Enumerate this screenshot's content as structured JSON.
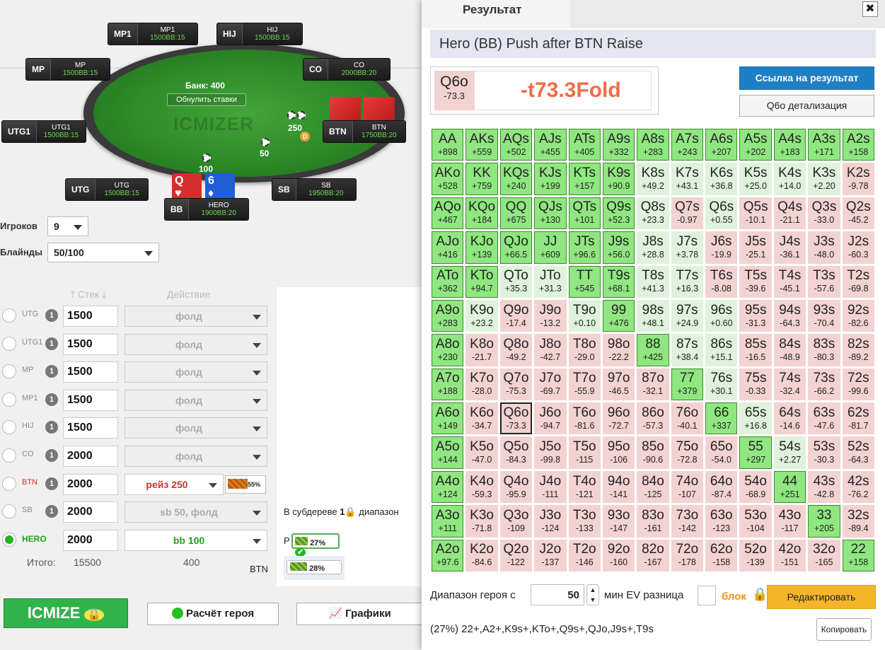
{
  "table": {
    "bank": "Банк: 400",
    "reset": "Обнулить ставки",
    "watermark": "ICMIZER",
    "pot_btn": "250",
    "pot_sb": "50",
    "pot_bb": "100",
    "dealer": "D",
    "seats": [
      {
        "pos": "MP1",
        "name": "MP1",
        "stack": "1500",
        "bb": "BB:15"
      },
      {
        "pos": "HIJ",
        "name": "HIJ",
        "stack": "1500",
        "bb": "BB:15"
      },
      {
        "pos": "MP",
        "name": "MP",
        "stack": "1500",
        "bb": "BB:15"
      },
      {
        "pos": "CO",
        "name": "CO",
        "stack": "2000",
        "bb": "BB:20"
      },
      {
        "pos": "UTG1",
        "name": "UTG1",
        "stack": "1500",
        "bb": "BB:15"
      },
      {
        "pos": "BTN",
        "name": "BTN",
        "stack": "1750",
        "bb": "BB:20"
      },
      {
        "pos": "UTG",
        "name": "UTG",
        "stack": "1500",
        "bb": "BB:15"
      },
      {
        "pos": "SB",
        "name": "SB",
        "stack": "1950",
        "bb": "BB:20"
      },
      {
        "pos": "BB",
        "name": "HERO",
        "stack": "1900",
        "bb": "BB:20"
      }
    ],
    "hero_cards": [
      {
        "rank": "Q",
        "suit": "♥",
        "color": "#d32f2f"
      },
      {
        "rank": "6",
        "suit": "♦",
        "color": "#1e5fd6"
      }
    ]
  },
  "setup": {
    "players_label": "Игроков",
    "players_value": "9",
    "blinds_label": "Блайнды",
    "blinds_value": "50/100",
    "stack_hdr": "Стек",
    "action_hdr": "Действие",
    "rows": [
      {
        "pos": "UTG",
        "stack": "1500",
        "action": "фолд"
      },
      {
        "pos": "UTG1",
        "stack": "1500",
        "action": "фолд"
      },
      {
        "pos": "MP",
        "stack": "1500",
        "action": "фолд"
      },
      {
        "pos": "MP1",
        "stack": "1500",
        "action": "фолд"
      },
      {
        "pos": "HIJ",
        "stack": "1500",
        "action": "фолд"
      },
      {
        "pos": "CO",
        "stack": "2000",
        "action": "фолд"
      },
      {
        "pos": "BTN",
        "stack": "2000",
        "action": "рейз 250"
      },
      {
        "pos": "SB",
        "stack": "2000",
        "action": "sb 50, фолд"
      },
      {
        "pos": "HERO",
        "stack": "2000",
        "action": "bb 100"
      }
    ],
    "row_num": "1",
    "btn_pct": "55%",
    "total_label": "Итого:",
    "total_stack": "15500",
    "total_action": "400"
  },
  "subtree": {
    "text_a": "В субдереве",
    "text_b": "1",
    "text_c": "диапазон",
    "r_label": "P",
    "r_pct": "27%",
    "btn_label": "BTN",
    "btn_pct": "28%"
  },
  "buttons": {
    "icmize": "ICMIZE",
    "hero_calc": "Расчёт героя",
    "charts": "Графики"
  },
  "result": {
    "tab": "Результат",
    "close": "✖",
    "title": "Hero (BB) Push after BTN Raise",
    "hand": "Q6o",
    "hand_ev": "-73.3",
    "verdict": "-t73.3Fold",
    "link_btn": "Ссылка на результат",
    "detail_btn": "Q6o детализация",
    "range_label": "Диапазон героя с",
    "range_value": "50",
    "ev_label": "мин EV разница",
    "block_label": "блок",
    "edit_btn": "Редактировать",
    "summary": "(27%) 22+,A2+,K9s+,KTo+,Q9s+,QJo,J9s+,T9s",
    "copy_btn": "Копировать",
    "colors": {
      "push": "#90e680",
      "pos_fold": "#dff2dc",
      "neg": "#f3d2d2",
      "accent": "#1f7fc4",
      "edit": "#f5b52a",
      "verdict": "#f26b4a"
    },
    "grid": [
      [
        [
          "AA",
          "+898"
        ],
        [
          "AKs",
          "+559"
        ],
        [
          "AQs",
          "+502"
        ],
        [
          "AJs",
          "+455"
        ],
        [
          "ATs",
          "+405"
        ],
        [
          "A9s",
          "+332"
        ],
        [
          "A8s",
          "+283"
        ],
        [
          "A7s",
          "+243"
        ],
        [
          "A6s",
          "+207"
        ],
        [
          "A5s",
          "+202"
        ],
        [
          "A4s",
          "+183"
        ],
        [
          "A3s",
          "+171"
        ],
        [
          "A2s",
          "+158"
        ]
      ],
      [
        [
          "AKo",
          "+528"
        ],
        [
          "KK",
          "+759"
        ],
        [
          "KQs",
          "+240"
        ],
        [
          "KJs",
          "+199"
        ],
        [
          "KTs",
          "+157"
        ],
        [
          "K9s",
          "+90.9"
        ],
        [
          "K8s",
          "+49.2"
        ],
        [
          "K7s",
          "+43.1"
        ],
        [
          "K6s",
          "+36.8"
        ],
        [
          "K5s",
          "+25.0"
        ],
        [
          "K4s",
          "+14.0"
        ],
        [
          "K3s",
          "+2.20"
        ],
        [
          "K2s",
          "-9.78"
        ]
      ],
      [
        [
          "AQo",
          "+467"
        ],
        [
          "KQo",
          "+184"
        ],
        [
          "QQ",
          "+675"
        ],
        [
          "QJs",
          "+130"
        ],
        [
          "QTs",
          "+101"
        ],
        [
          "Q9s",
          "+52.3"
        ],
        [
          "Q8s",
          "+23.3"
        ],
        [
          "Q7s",
          "-0.97"
        ],
        [
          "Q6s",
          "+0.55"
        ],
        [
          "Q5s",
          "-10.1"
        ],
        [
          "Q4s",
          "-21.1"
        ],
        [
          "Q3s",
          "-33.0"
        ],
        [
          "Q2s",
          "-45.2"
        ]
      ],
      [
        [
          "AJo",
          "+416"
        ],
        [
          "KJo",
          "+139"
        ],
        [
          "QJo",
          "+66.5"
        ],
        [
          "JJ",
          "+609"
        ],
        [
          "JTs",
          "+96.6"
        ],
        [
          "J9s",
          "+56.0"
        ],
        [
          "J8s",
          "+28.8"
        ],
        [
          "J7s",
          "+3.78"
        ],
        [
          "J6s",
          "-19.9"
        ],
        [
          "J5s",
          "-25.1"
        ],
        [
          "J4s",
          "-36.1"
        ],
        [
          "J3s",
          "-48.0"
        ],
        [
          "J2s",
          "-60.3"
        ]
      ],
      [
        [
          "ATo",
          "+362"
        ],
        [
          "KTo",
          "+94.7"
        ],
        [
          "QTo",
          "+35.3"
        ],
        [
          "JTo",
          "+31.3"
        ],
        [
          "TT",
          "+545"
        ],
        [
          "T9s",
          "+68.1"
        ],
        [
          "T8s",
          "+41.3"
        ],
        [
          "T7s",
          "+16.3"
        ],
        [
          "T6s",
          "-8.08"
        ],
        [
          "T5s",
          "-39.6"
        ],
        [
          "T4s",
          "-45.1"
        ],
        [
          "T3s",
          "-57.6"
        ],
        [
          "T2s",
          "-69.8"
        ]
      ],
      [
        [
          "A9o",
          "+283"
        ],
        [
          "K9o",
          "+23.2"
        ],
        [
          "Q9o",
          "-17.4"
        ],
        [
          "J9o",
          "-13.2"
        ],
        [
          "T9o",
          "+0.10"
        ],
        [
          "99",
          "+476"
        ],
        [
          "98s",
          "+48.1"
        ],
        [
          "97s",
          "+24.9"
        ],
        [
          "96s",
          "+0.60"
        ],
        [
          "95s",
          "-31.3"
        ],
        [
          "94s",
          "-64.3"
        ],
        [
          "93s",
          "-70.4"
        ],
        [
          "92s",
          "-82.6"
        ]
      ],
      [
        [
          "A8o",
          "+230"
        ],
        [
          "K8o",
          "-21.7"
        ],
        [
          "Q8o",
          "-49.2"
        ],
        [
          "J8o",
          "-42.7"
        ],
        [
          "T8o",
          "-29.0"
        ],
        [
          "98o",
          "-22.2"
        ],
        [
          "88",
          "+425"
        ],
        [
          "87s",
          "+38.4"
        ],
        [
          "86s",
          "+15.1"
        ],
        [
          "85s",
          "-16.5"
        ],
        [
          "84s",
          "-48.9"
        ],
        [
          "83s",
          "-80.3"
        ],
        [
          "82s",
          "-89.2"
        ]
      ],
      [
        [
          "A7o",
          "+188"
        ],
        [
          "K7o",
          "-28.0"
        ],
        [
          "Q7o",
          "-75.3"
        ],
        [
          "J7o",
          "-69.7"
        ],
        [
          "T7o",
          "-55.9"
        ],
        [
          "97o",
          "-46.5"
        ],
        [
          "87o",
          "-32.1"
        ],
        [
          "77",
          "+379"
        ],
        [
          "76s",
          "+30.1"
        ],
        [
          "75s",
          "-0.33"
        ],
        [
          "74s",
          "-32.4"
        ],
        [
          "73s",
          "-66.2"
        ],
        [
          "72s",
          "-99.6"
        ]
      ],
      [
        [
          "A6o",
          "+149"
        ],
        [
          "K6o",
          "-34.7"
        ],
        [
          "Q6o",
          "-73.3"
        ],
        [
          "J6o",
          "-94.7"
        ],
        [
          "T6o",
          "-81.6"
        ],
        [
          "96o",
          "-72.7"
        ],
        [
          "86o",
          "-57.3"
        ],
        [
          "76o",
          "-40.1"
        ],
        [
          "66",
          "+337"
        ],
        [
          "65s",
          "+16.8"
        ],
        [
          "64s",
          "-14.6"
        ],
        [
          "63s",
          "-47.6"
        ],
        [
          "62s",
          "-81.7"
        ]
      ],
      [
        [
          "A5o",
          "+144"
        ],
        [
          "K5o",
          "-47.0"
        ],
        [
          "Q5o",
          "-84.3"
        ],
        [
          "J5o",
          "-99.8"
        ],
        [
          "T5o",
          "-115"
        ],
        [
          "95o",
          "-106"
        ],
        [
          "85o",
          "-90.6"
        ],
        [
          "75o",
          "-72.8"
        ],
        [
          "65o",
          "-54.0"
        ],
        [
          "55",
          "+297"
        ],
        [
          "54s",
          "+2.27"
        ],
        [
          "53s",
          "-30.3"
        ],
        [
          "52s",
          "-64.3"
        ]
      ],
      [
        [
          "A4o",
          "+124"
        ],
        [
          "K4o",
          "-59.3"
        ],
        [
          "Q4o",
          "-95.9"
        ],
        [
          "J4o",
          "-111"
        ],
        [
          "T4o",
          "-121"
        ],
        [
          "94o",
          "-141"
        ],
        [
          "84o",
          "-125"
        ],
        [
          "74o",
          "-107"
        ],
        [
          "64o",
          "-87.4"
        ],
        [
          "54o",
          "-68.9"
        ],
        [
          "44",
          "+251"
        ],
        [
          "43s",
          "-42.8"
        ],
        [
          "42s",
          "-76.2"
        ]
      ],
      [
        [
          "A3o",
          "+111"
        ],
        [
          "K3o",
          "-71.8"
        ],
        [
          "Q3o",
          "-109"
        ],
        [
          "J3o",
          "-124"
        ],
        [
          "T3o",
          "-133"
        ],
        [
          "93o",
          "-147"
        ],
        [
          "83o",
          "-161"
        ],
        [
          "73o",
          "-142"
        ],
        [
          "63o",
          "-123"
        ],
        [
          "53o",
          "-104"
        ],
        [
          "43o",
          "-117"
        ],
        [
          "33",
          "+205"
        ],
        [
          "32s",
          "-89.4"
        ]
      ],
      [
        [
          "A2o",
          "+97.6"
        ],
        [
          "K2o",
          "-84.6"
        ],
        [
          "Q2o",
          "-122"
        ],
        [
          "J2o",
          "-137"
        ],
        [
          "T2o",
          "-146"
        ],
        [
          "92o",
          "-160"
        ],
        [
          "82o",
          "-167"
        ],
        [
          "72o",
          "-178"
        ],
        [
          "62o",
          "-158"
        ],
        [
          "52o",
          "-139"
        ],
        [
          "42o",
          "-151"
        ],
        [
          "32o",
          "-165"
        ],
        [
          "22",
          "+158"
        ]
      ]
    ],
    "push_hands": [
      "AA",
      "AKs",
      "AQs",
      "AJs",
      "ATs",
      "A9s",
      "A8s",
      "A7s",
      "A6s",
      "A5s",
      "A4s",
      "A3s",
      "A2s",
      "AKo",
      "KK",
      "KQs",
      "KJs",
      "KTs",
      "K9s",
      "AQo",
      "KQo",
      "QQ",
      "QJs",
      "QTs",
      "Q9s",
      "AJo",
      "KJo",
      "QJo",
      "JJ",
      "JTs",
      "J9s",
      "ATo",
      "KTo",
      "TT",
      "T9s",
      "A9o",
      "99",
      "A8o",
      "88",
      "A7o",
      "77",
      "A6o",
      "66",
      "A5o",
      "55",
      "A4o",
      "44",
      "A3o",
      "33",
      "A2o",
      "22"
    ],
    "selected_hand": "Q6o"
  }
}
